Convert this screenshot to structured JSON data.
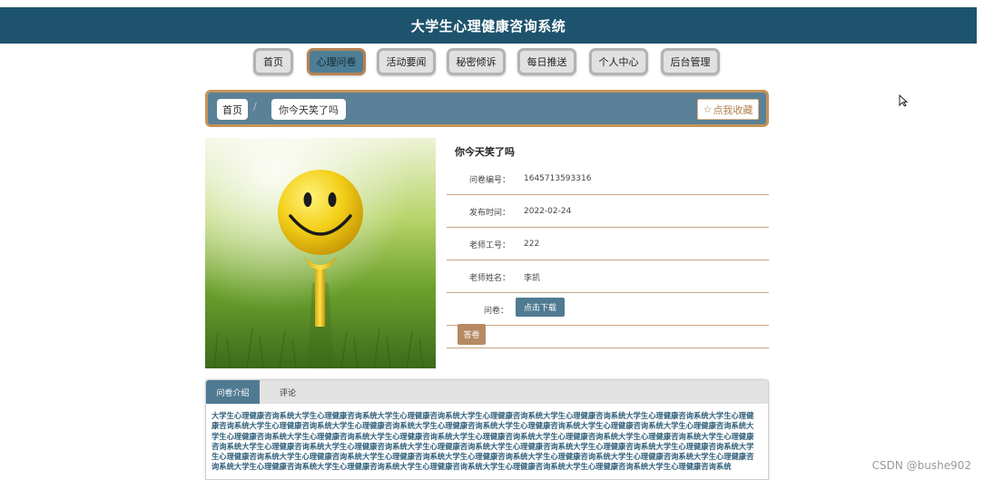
{
  "header": {
    "title": "大学生心理健康咨询系统"
  },
  "nav": {
    "items": [
      {
        "label": "首页"
      },
      {
        "label": "心理问卷"
      },
      {
        "label": "活动要闻"
      },
      {
        "label": "秘密倾诉"
      },
      {
        "label": "每日推送"
      },
      {
        "label": "个人中心"
      },
      {
        "label": "后台管理"
      }
    ],
    "active_index": 1
  },
  "breadcrumb": {
    "home": "首页",
    "separator": "/",
    "current": "你今天笑了吗",
    "favorite_icon": "star-icon",
    "favorite_label": "点我收藏"
  },
  "detail": {
    "title": "你今天笑了吗",
    "rows": [
      {
        "label": "问卷编号：",
        "value": "1645713593316"
      },
      {
        "label": "发布时间：",
        "value": "2022-02-24"
      },
      {
        "label": "老师工号：",
        "value": "222"
      },
      {
        "label": "老师姓名：",
        "value": "李凯"
      }
    ],
    "file": {
      "label": "问卷：",
      "download_label": "点击下载"
    },
    "answer_label": "答卷"
  },
  "tabs": {
    "items": [
      {
        "label": "问卷介绍"
      },
      {
        "label": "评论"
      }
    ],
    "active_index": 0,
    "intro_text": "大学生心理健康咨询系统大学生心理健康咨询系统大学生心理健康咨询系统大学生心理健康咨询系统大学生心理健康咨询系统大学生心理健康咨询系统大学生心理健康咨询系统大学生心理健康咨询系统大学生心理健康咨询系统大学生心理健康咨询系统大学生心理健康咨询系统大学生心理健康咨询系统大学生心理健康咨询系统大学生心理健康咨询系统大学生心理健康咨询系统大学生心理健康咨询系统大学生心理健康咨询系统大学生心理健康咨询系统大学生心理健康咨询系统大学生心理健康咨询系统大学生心理健康咨询系统大学生心理健康咨询系统大学生心理健康咨询系统大学生心理健康咨询系统大学生心理健康咨询系统大学生心理健康咨询系统大学生心理健康咨询系统大学生心理健康咨询系统大学生心理健康咨询系统大学生心理健康咨询系统大学生心理健康咨询系统大学生心理健康咨询系统大学生心理健康咨询系统大学生心理健康咨询系统大学生心理健康咨询系统大学生心理健康咨询系统大学生心理健康咨询系统大学生心理健康咨询系统大学生心理健康咨询系统"
  },
  "watermark": "CSDN @bushe902",
  "colors": {
    "header_bg": "#1d536c",
    "accent": "#4f7a92",
    "border_accent": "#c59358",
    "answer_button": "#b58a63"
  }
}
